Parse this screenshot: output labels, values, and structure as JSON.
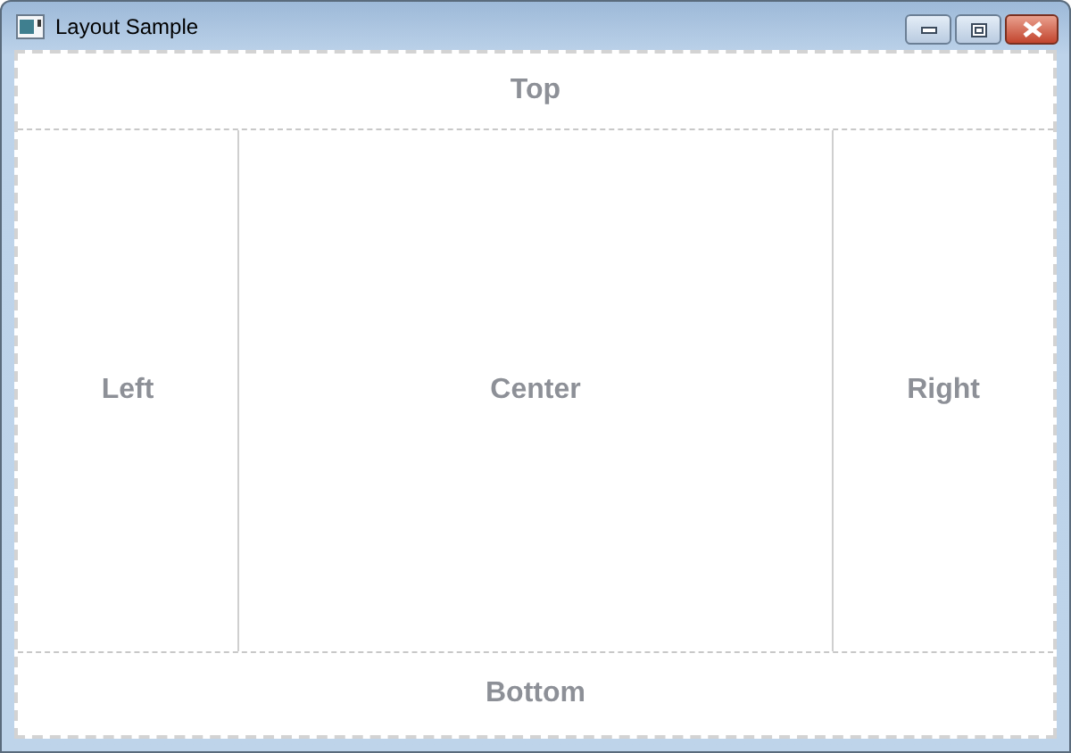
{
  "window": {
    "title": "Layout Sample"
  },
  "regions": {
    "top": "Top",
    "left": "Left",
    "center": "Center",
    "right": "Right",
    "bottom": "Bottom"
  }
}
